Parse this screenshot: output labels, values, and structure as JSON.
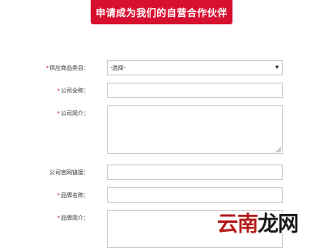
{
  "header": {
    "apply_button_label": "申请成为我们的自营合作伙伴"
  },
  "form": {
    "required_mark": "*",
    "category": {
      "label": "供应商品类目：",
      "selected": "-选择-"
    },
    "company_name": {
      "label": "公司全称：",
      "value": ""
    },
    "company_intro": {
      "label": "公司简介：",
      "value": ""
    },
    "company_site": {
      "label": "公司官网链接：",
      "value": ""
    },
    "brand_name": {
      "label": "品牌名称：",
      "value": ""
    },
    "brand_intro": {
      "label": "品牌简介：",
      "value": ""
    }
  },
  "watermark": {
    "part1": "云南",
    "part2": "龙网"
  }
}
